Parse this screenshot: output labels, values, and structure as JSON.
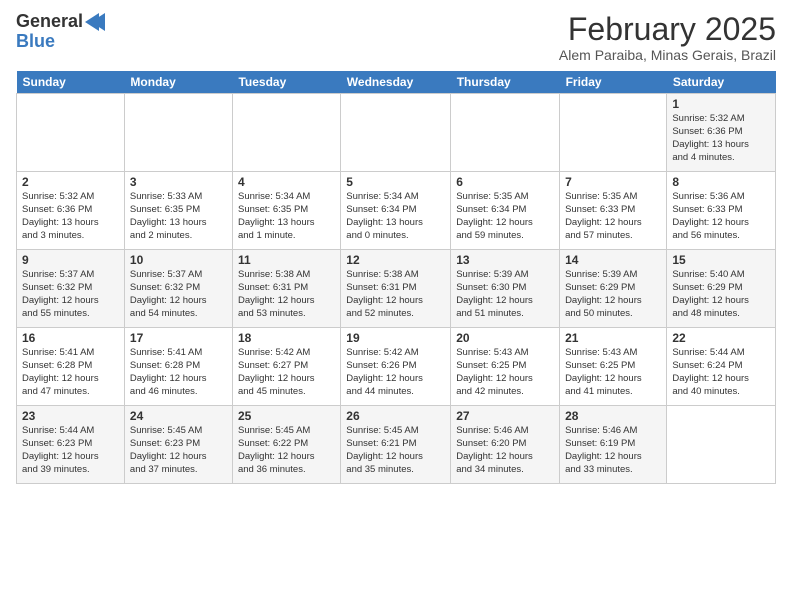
{
  "header": {
    "logo_line1": "General",
    "logo_line2": "Blue",
    "month": "February 2025",
    "location": "Alem Paraiba, Minas Gerais, Brazil"
  },
  "weekdays": [
    "Sunday",
    "Monday",
    "Tuesday",
    "Wednesday",
    "Thursday",
    "Friday",
    "Saturday"
  ],
  "weeks": [
    [
      {
        "day": "",
        "info": ""
      },
      {
        "day": "",
        "info": ""
      },
      {
        "day": "",
        "info": ""
      },
      {
        "day": "",
        "info": ""
      },
      {
        "day": "",
        "info": ""
      },
      {
        "day": "",
        "info": ""
      },
      {
        "day": "1",
        "info": "Sunrise: 5:32 AM\nSunset: 6:36 PM\nDaylight: 13 hours\nand 4 minutes."
      }
    ],
    [
      {
        "day": "2",
        "info": "Sunrise: 5:32 AM\nSunset: 6:36 PM\nDaylight: 13 hours\nand 3 minutes."
      },
      {
        "day": "3",
        "info": "Sunrise: 5:33 AM\nSunset: 6:35 PM\nDaylight: 13 hours\nand 2 minutes."
      },
      {
        "day": "4",
        "info": "Sunrise: 5:34 AM\nSunset: 6:35 PM\nDaylight: 13 hours\nand 1 minute."
      },
      {
        "day": "5",
        "info": "Sunrise: 5:34 AM\nSunset: 6:34 PM\nDaylight: 13 hours\nand 0 minutes."
      },
      {
        "day": "6",
        "info": "Sunrise: 5:35 AM\nSunset: 6:34 PM\nDaylight: 12 hours\nand 59 minutes."
      },
      {
        "day": "7",
        "info": "Sunrise: 5:35 AM\nSunset: 6:33 PM\nDaylight: 12 hours\nand 57 minutes."
      },
      {
        "day": "8",
        "info": "Sunrise: 5:36 AM\nSunset: 6:33 PM\nDaylight: 12 hours\nand 56 minutes."
      }
    ],
    [
      {
        "day": "9",
        "info": "Sunrise: 5:37 AM\nSunset: 6:32 PM\nDaylight: 12 hours\nand 55 minutes."
      },
      {
        "day": "10",
        "info": "Sunrise: 5:37 AM\nSunset: 6:32 PM\nDaylight: 12 hours\nand 54 minutes."
      },
      {
        "day": "11",
        "info": "Sunrise: 5:38 AM\nSunset: 6:31 PM\nDaylight: 12 hours\nand 53 minutes."
      },
      {
        "day": "12",
        "info": "Sunrise: 5:38 AM\nSunset: 6:31 PM\nDaylight: 12 hours\nand 52 minutes."
      },
      {
        "day": "13",
        "info": "Sunrise: 5:39 AM\nSunset: 6:30 PM\nDaylight: 12 hours\nand 51 minutes."
      },
      {
        "day": "14",
        "info": "Sunrise: 5:39 AM\nSunset: 6:29 PM\nDaylight: 12 hours\nand 50 minutes."
      },
      {
        "day": "15",
        "info": "Sunrise: 5:40 AM\nSunset: 6:29 PM\nDaylight: 12 hours\nand 48 minutes."
      }
    ],
    [
      {
        "day": "16",
        "info": "Sunrise: 5:41 AM\nSunset: 6:28 PM\nDaylight: 12 hours\nand 47 minutes."
      },
      {
        "day": "17",
        "info": "Sunrise: 5:41 AM\nSunset: 6:28 PM\nDaylight: 12 hours\nand 46 minutes."
      },
      {
        "day": "18",
        "info": "Sunrise: 5:42 AM\nSunset: 6:27 PM\nDaylight: 12 hours\nand 45 minutes."
      },
      {
        "day": "19",
        "info": "Sunrise: 5:42 AM\nSunset: 6:26 PM\nDaylight: 12 hours\nand 44 minutes."
      },
      {
        "day": "20",
        "info": "Sunrise: 5:43 AM\nSunset: 6:25 PM\nDaylight: 12 hours\nand 42 minutes."
      },
      {
        "day": "21",
        "info": "Sunrise: 5:43 AM\nSunset: 6:25 PM\nDaylight: 12 hours\nand 41 minutes."
      },
      {
        "day": "22",
        "info": "Sunrise: 5:44 AM\nSunset: 6:24 PM\nDaylight: 12 hours\nand 40 minutes."
      }
    ],
    [
      {
        "day": "23",
        "info": "Sunrise: 5:44 AM\nSunset: 6:23 PM\nDaylight: 12 hours\nand 39 minutes."
      },
      {
        "day": "24",
        "info": "Sunrise: 5:45 AM\nSunset: 6:23 PM\nDaylight: 12 hours\nand 37 minutes."
      },
      {
        "day": "25",
        "info": "Sunrise: 5:45 AM\nSunset: 6:22 PM\nDaylight: 12 hours\nand 36 minutes."
      },
      {
        "day": "26",
        "info": "Sunrise: 5:45 AM\nSunset: 6:21 PM\nDaylight: 12 hours\nand 35 minutes."
      },
      {
        "day": "27",
        "info": "Sunrise: 5:46 AM\nSunset: 6:20 PM\nDaylight: 12 hours\nand 34 minutes."
      },
      {
        "day": "28",
        "info": "Sunrise: 5:46 AM\nSunset: 6:19 PM\nDaylight: 12 hours\nand 33 minutes."
      },
      {
        "day": "",
        "info": ""
      }
    ]
  ]
}
